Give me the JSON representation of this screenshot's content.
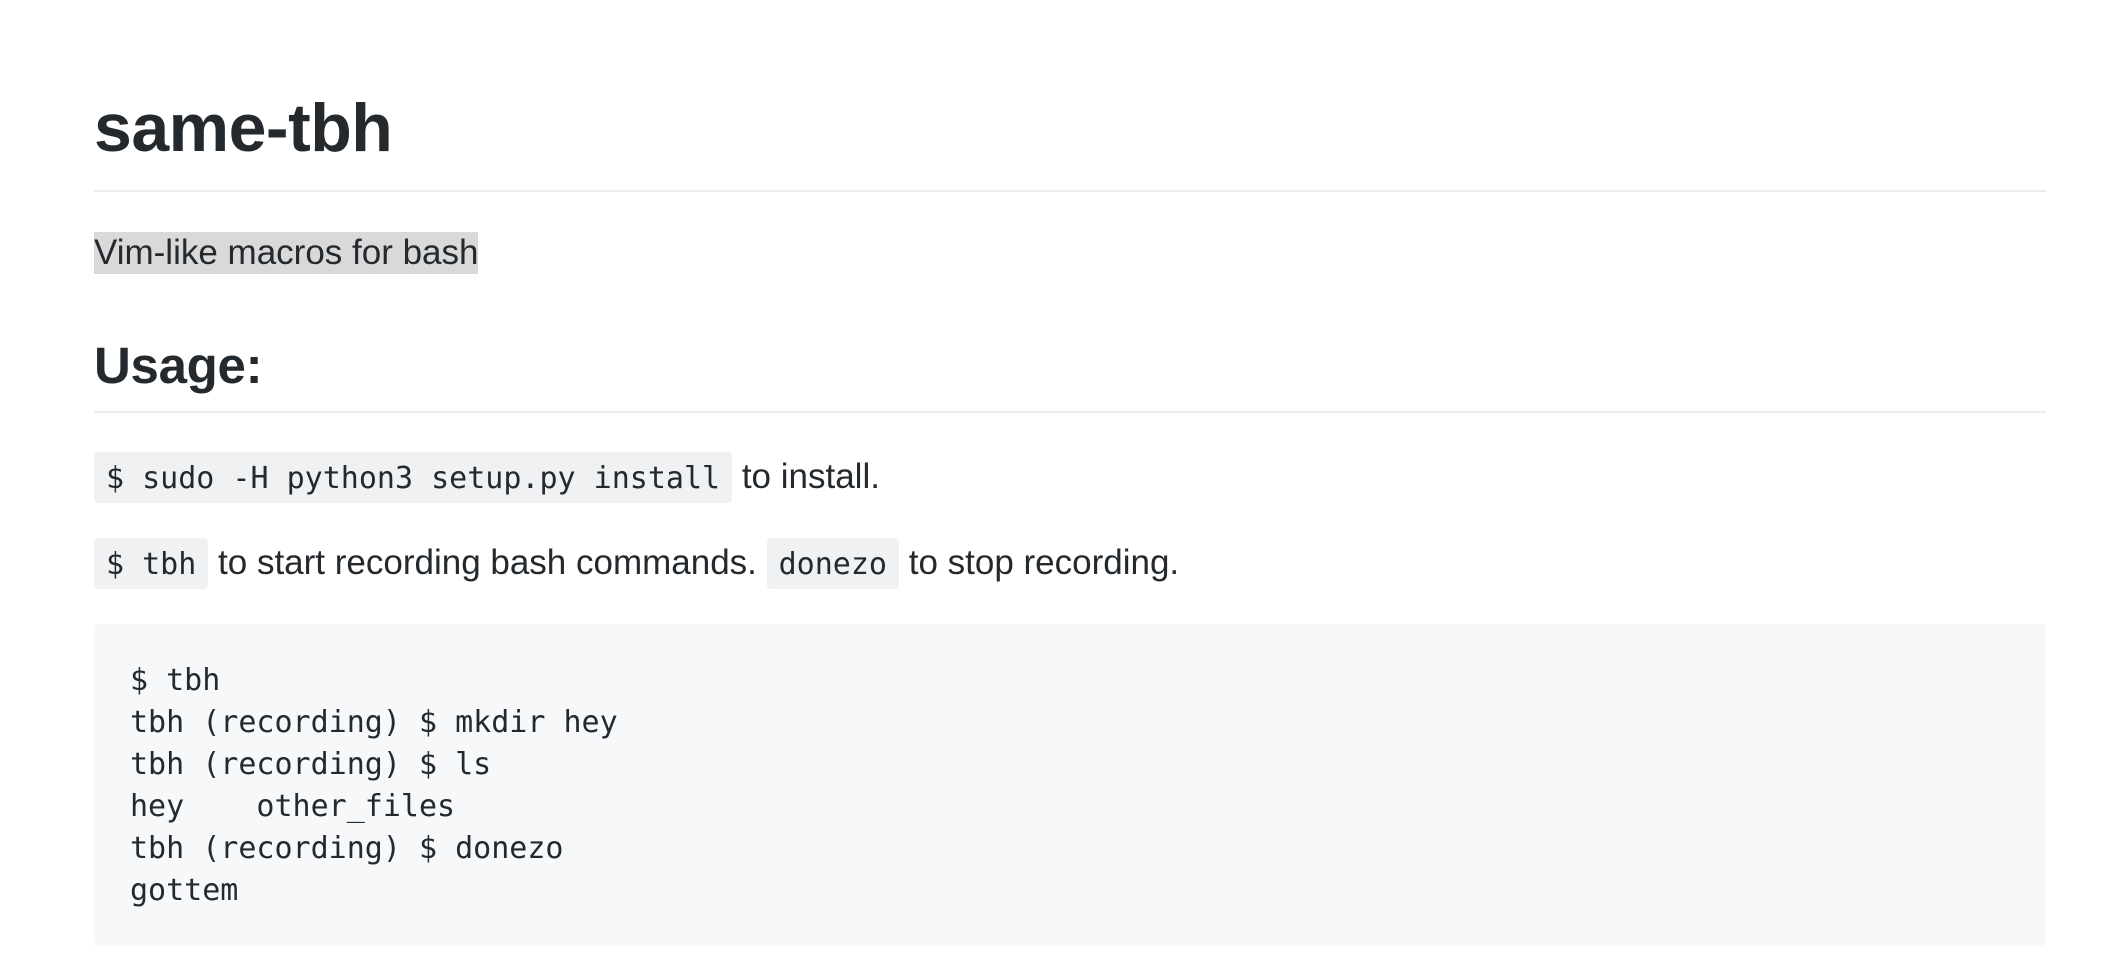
{
  "title": "same-tbh",
  "description": "Vim-like macros for bash",
  "usage_heading": "Usage:",
  "install_line": {
    "code": "$ sudo -H python3 setup.py install",
    "text": " to install."
  },
  "record_line": {
    "code1": "$ tbh",
    "text1": " to start recording bash commands. ",
    "code2": "donezo",
    "text2": " to stop recording."
  },
  "code_block": {
    "lines": [
      "$ tbh",
      "tbh (recording) $ mkdir hey",
      "tbh (recording) $ ls",
      "hey    other_files",
      "tbh (recording) $ donezo",
      "gottem"
    ]
  },
  "colors": {
    "text": "#24292e",
    "rule": "#eaecef",
    "code_bg": "#f6f8fa",
    "selection": "#d9d9d9"
  }
}
